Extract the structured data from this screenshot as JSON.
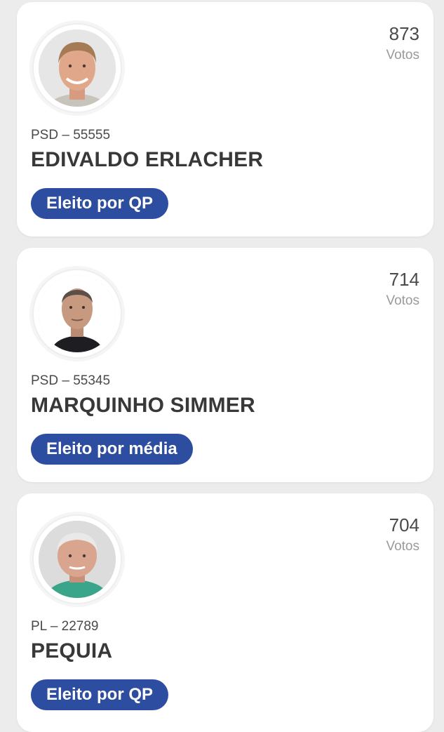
{
  "candidates": [
    {
      "votes": "873",
      "votes_label": "Votos",
      "party": "PSD – 55555",
      "name": "EDIVALDO ERLACHER",
      "status": "Eleito por QP"
    },
    {
      "votes": "714",
      "votes_label": "Votos",
      "party": "PSD – 55345",
      "name": "MARQUINHO SIMMER",
      "status": "Eleito por média"
    },
    {
      "votes": "704",
      "votes_label": "Votos",
      "party": "PL – 22789",
      "name": "PEQUIA",
      "status": "Eleito por QP"
    }
  ],
  "colors": {
    "badge": "#2d4da0",
    "card": "#ffffff",
    "background": "#ececec"
  }
}
